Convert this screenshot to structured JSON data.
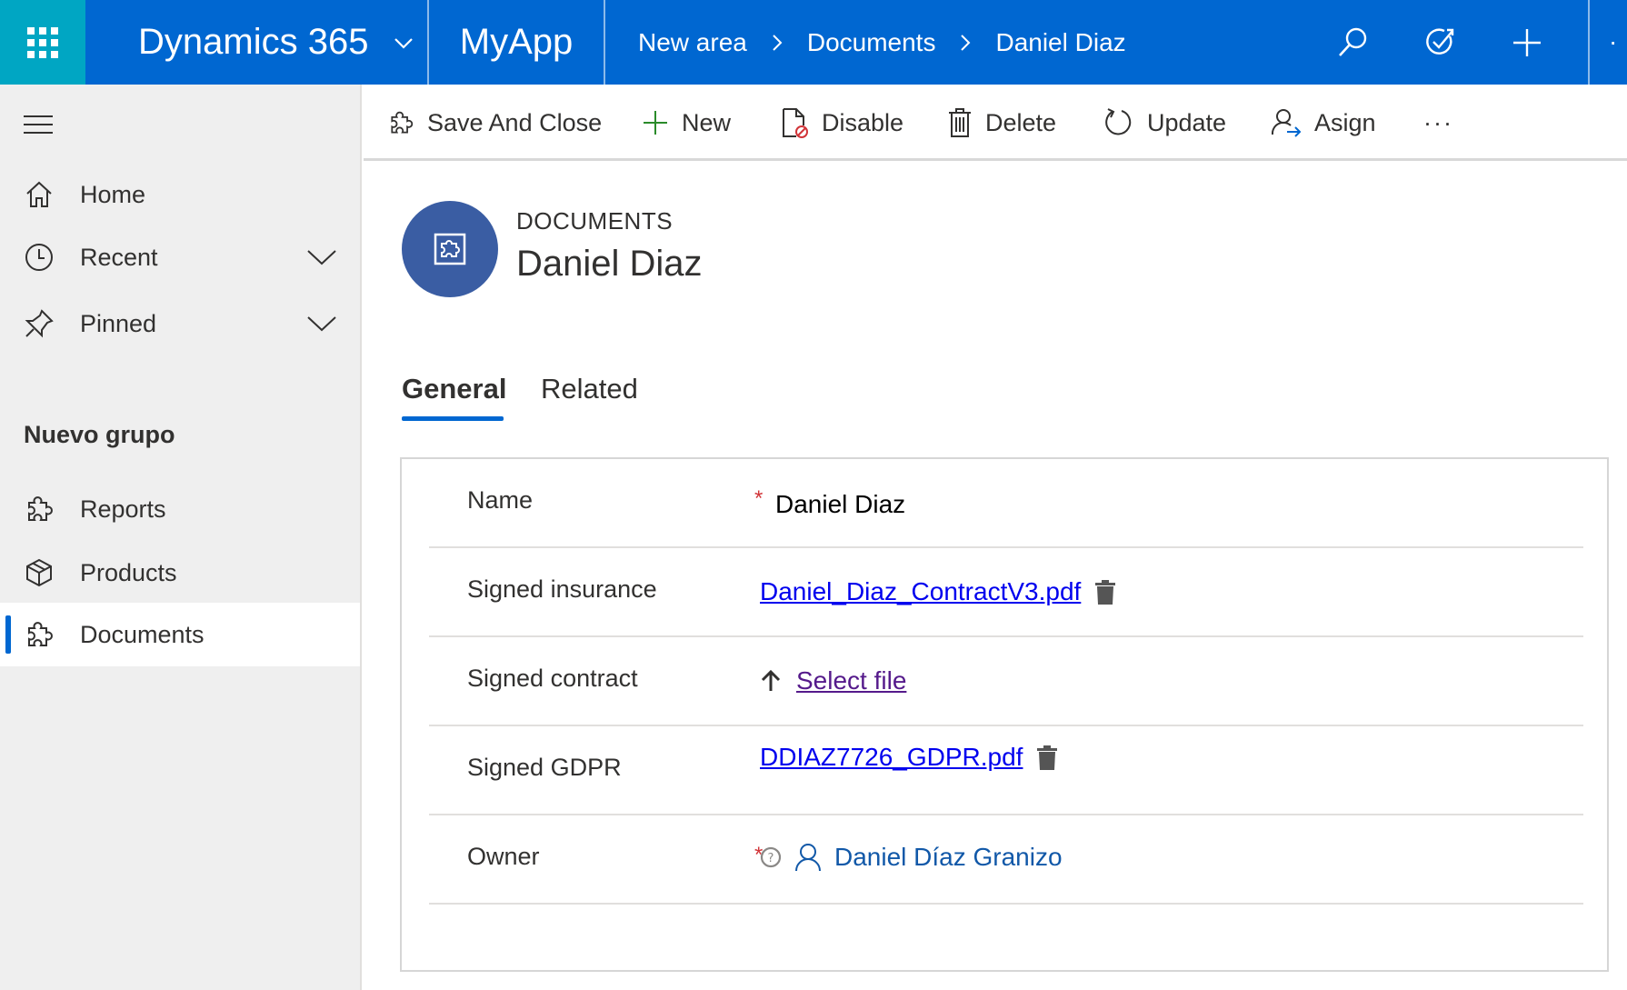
{
  "topbar": {
    "brand": "Dynamics 365",
    "app_name": "MyApp",
    "breadcrumbs": [
      "New area",
      "Documents",
      "Daniel Diaz"
    ]
  },
  "sidenav": {
    "items": [
      {
        "label": "Home",
        "icon": "home-icon"
      },
      {
        "label": "Recent",
        "icon": "clock-icon"
      },
      {
        "label": "Pinned",
        "icon": "pin-icon"
      }
    ],
    "group_title": "Nuevo grupo",
    "group_items": [
      {
        "label": "Reports",
        "icon": "puzzle-icon"
      },
      {
        "label": "Products",
        "icon": "cube-icon"
      },
      {
        "label": "Documents",
        "icon": "puzzle-icon",
        "selected": true
      }
    ]
  },
  "commands": {
    "save_close": "Save And Close",
    "new": "New",
    "disable": "Disable",
    "delete": "Delete",
    "update": "Update",
    "assign": "Asign",
    "more": "···"
  },
  "record": {
    "entity_type": "DOCUMENTS",
    "title": "Daniel Diaz"
  },
  "tabs": {
    "general": "General",
    "related": "Related"
  },
  "form": {
    "name": {
      "label": "Name",
      "required": "*",
      "value": "Daniel Diaz"
    },
    "signed_insurance": {
      "label": "Signed insurance",
      "file": "Daniel_Diaz_ContractV3.pdf"
    },
    "signed_contract": {
      "label": "Signed contract",
      "action": "Select file"
    },
    "signed_gdpr": {
      "label": "Signed GDPR",
      "file": "DDIAZ7726_GDPR.pdf"
    },
    "owner": {
      "label": "Owner",
      "required": "*",
      "value": "Daniel Díaz Granizo"
    }
  },
  "colors": {
    "topbar": "#0067d1",
    "waffle": "#00a6c3",
    "avatar": "#3a5da3",
    "required": "#d13438",
    "link": "#0000ee"
  }
}
